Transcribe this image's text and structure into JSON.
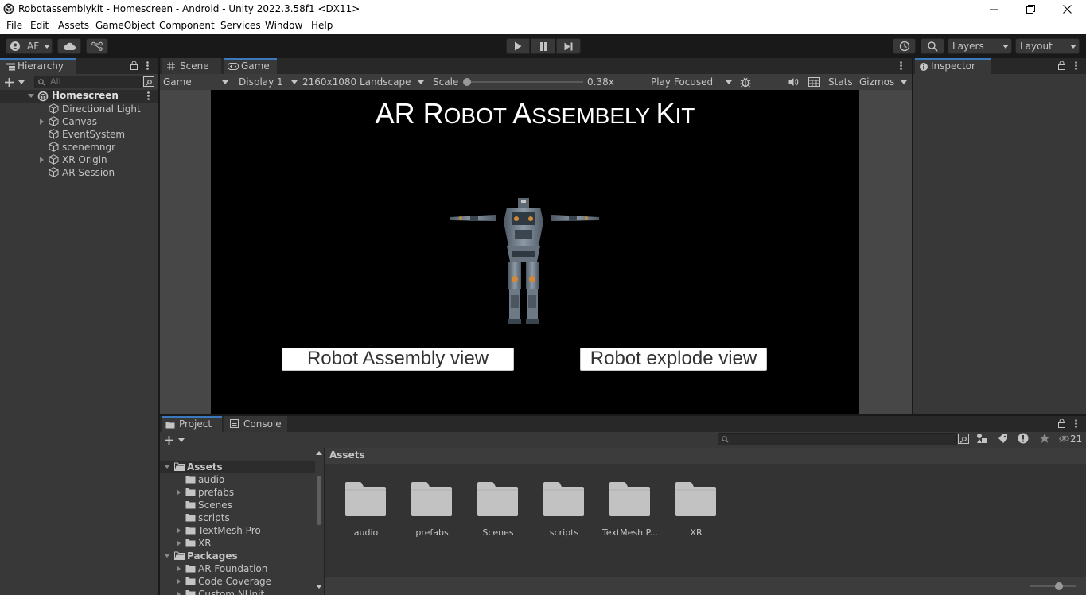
{
  "window": {
    "title": "Robotassemblykit - Homescreen - Android - Unity 2022.3.58f1 <DX11>"
  },
  "menu": [
    "File",
    "Edit",
    "Assets",
    "GameObject",
    "Component",
    "Services",
    "Window",
    "Help"
  ],
  "toolbar": {
    "account": "AF",
    "layers": "Layers",
    "layout": "Layout"
  },
  "hierarchy": {
    "tab": "Hierarchy",
    "search_placeholder": "All",
    "scene": "Homescreen",
    "items": [
      {
        "label": "Directional Light",
        "expandable": false
      },
      {
        "label": "Canvas",
        "expandable": true
      },
      {
        "label": "EventSystem",
        "expandable": false
      },
      {
        "label": "scenemngr",
        "expandable": false
      },
      {
        "label": "XR Origin",
        "expandable": true
      },
      {
        "label": "AR Session",
        "expandable": false
      }
    ]
  },
  "scene_tabs": {
    "scene": "Scene",
    "game": "Game"
  },
  "game_toolbar": {
    "mode": "Game",
    "display": "Display 1",
    "resolution": "2160x1080 Landscape",
    "scale_label": "Scale",
    "scale_value": "0.38x",
    "play_mode": "Play Focused",
    "stats": "Stats",
    "gizmos": "Gizmos"
  },
  "game_view": {
    "title_parts": [
      {
        "text": "AR ",
        "sc": false
      },
      {
        "text": "R",
        "sc": false
      },
      {
        "text": "OBOT ",
        "sc": true
      },
      {
        "text": "A",
        "sc": false
      },
      {
        "text": "SSEMBELY ",
        "sc": true
      },
      {
        "text": "K",
        "sc": false
      },
      {
        "text": "IT",
        "sc": true
      }
    ],
    "button_assembly": "Robot Assembly view",
    "button_explode": "Robot explode view"
  },
  "inspector": {
    "tab": "Inspector"
  },
  "project": {
    "tab_project": "Project",
    "tab_console": "Console",
    "hidden_count": "21",
    "breadcrumb": "Assets",
    "tree": [
      {
        "label": "Assets",
        "depth": 0,
        "bold": true,
        "fold": "open"
      },
      {
        "label": "audio",
        "depth": 1,
        "bold": false,
        "fold": "none"
      },
      {
        "label": "prefabs",
        "depth": 1,
        "bold": false,
        "fold": "closed"
      },
      {
        "label": "Scenes",
        "depth": 1,
        "bold": false,
        "fold": "none"
      },
      {
        "label": "scripts",
        "depth": 1,
        "bold": false,
        "fold": "none"
      },
      {
        "label": "TextMesh Pro",
        "depth": 1,
        "bold": false,
        "fold": "closed"
      },
      {
        "label": "XR",
        "depth": 1,
        "bold": false,
        "fold": "closed"
      },
      {
        "label": "Packages",
        "depth": 0,
        "bold": true,
        "fold": "open"
      },
      {
        "label": "AR Foundation",
        "depth": 1,
        "bold": false,
        "fold": "closed"
      },
      {
        "label": "Code Coverage",
        "depth": 1,
        "bold": false,
        "fold": "closed"
      },
      {
        "label": "Custom NUnit",
        "depth": 1,
        "bold": false,
        "fold": "closed"
      }
    ],
    "grid": [
      "audio",
      "prefabs",
      "Scenes",
      "scripts",
      "TextMesh P...",
      "XR"
    ]
  },
  "colors": {
    "accent": "#3a79bb",
    "panel": "#383838",
    "tab_strip": "#282828",
    "game_bg": "#000000"
  }
}
